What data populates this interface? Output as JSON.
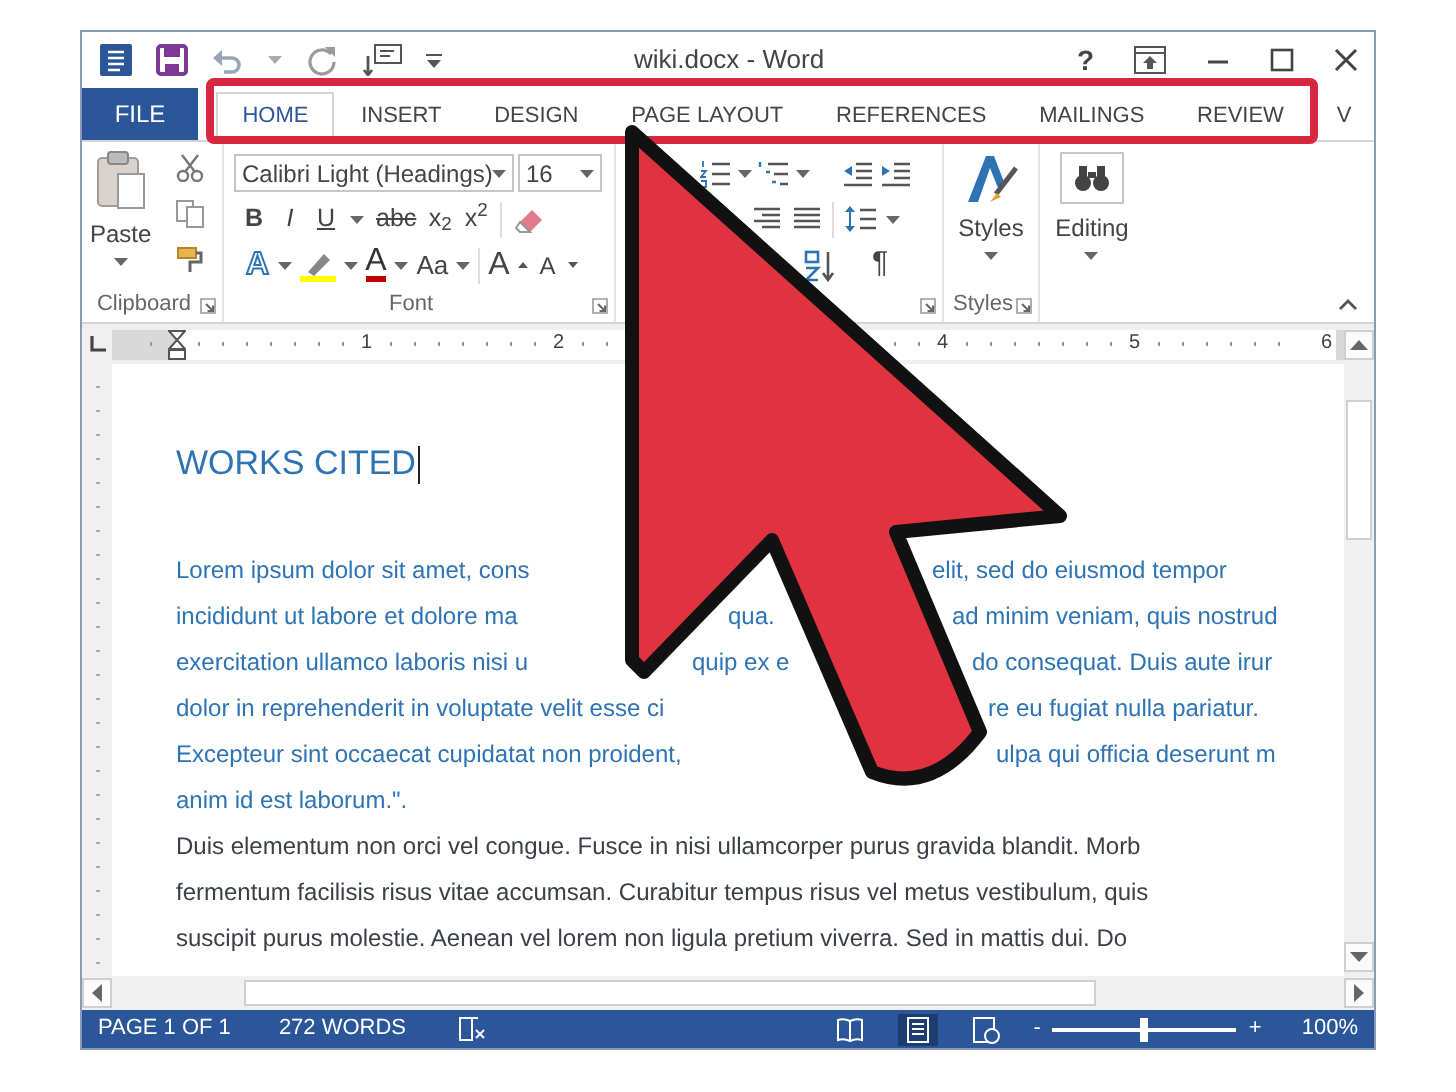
{
  "window": {
    "title": "wiki.docx - Word",
    "help": "?"
  },
  "tabs": [
    {
      "label": "FILE",
      "kind": "file",
      "selected": false
    },
    {
      "label": "HOME",
      "kind": "tab",
      "selected": true
    },
    {
      "label": "INSERT",
      "kind": "tab",
      "selected": false
    },
    {
      "label": "DESIGN",
      "kind": "tab",
      "selected": false
    },
    {
      "label": "PAGE LAYOUT",
      "kind": "tab",
      "selected": false
    },
    {
      "label": "REFERENCES",
      "kind": "tab",
      "selected": false
    },
    {
      "label": "MAILINGS",
      "kind": "tab",
      "selected": false
    },
    {
      "label": "REVIEW",
      "kind": "tab",
      "selected": false
    },
    {
      "label": "V",
      "kind": "tab",
      "selected": false
    }
  ],
  "clipboard": {
    "paste_label": "Paste",
    "group_label": "Clipboard"
  },
  "font": {
    "font_name": "Calibri Light (Headings)",
    "font_size": "16",
    "format_buttons": [
      "B",
      "I",
      "U",
      "abc",
      "x$_{2}$",
      "x$^{2}$"
    ],
    "text_effects": "A",
    "font_color": "A",
    "change_case": "Aa",
    "grow": "A",
    "shrink": "A",
    "group_label": "Font"
  },
  "paragraph": {
    "show_marks": "¶"
  },
  "styles": {
    "button_label": "Styles",
    "group_label": "Styles"
  },
  "editing": {
    "button_label": "Editing"
  },
  "ruler": {
    "numbers": [
      "1",
      "2",
      "4",
      "5",
      "6"
    ]
  },
  "document": {
    "heading": "WORKS CITED",
    "paragraphs": [
      {
        "kind": "accent",
        "lines": [
          [
            "Lorem ipsum dolor sit amet, cons",
            "elit, sed do eiusmod tempor"
          ],
          [
            "incididunt ut labore et dolore ma",
            "qua.",
            "ad minim veniam, quis nostrud"
          ],
          [
            "exercitation ullamco laboris nisi u",
            "quip ex e",
            "do consequat. Duis aute irur"
          ],
          [
            "dolor in reprehenderit in voluptate velit esse ci",
            "re eu fugiat nulla pariatur."
          ],
          [
            "Excepteur sint occaecat cupidatat non proident,",
            "ulpa qui officia deserunt m"
          ],
          [
            "anim id est laborum.\"."
          ]
        ]
      },
      {
        "kind": "plain",
        "lines": [
          [
            "Duis elementum non orci vel congue. Fusce in nisi ullamcorper purus gravida blandit. Morb"
          ],
          [
            "fermentum facilisis risus vitae accumsan. Curabitur tempus risus vel metus vestibulum, quis"
          ],
          [
            "suscipit purus molestie. Aenean vel lorem non ligula pretium viverra. Sed in mattis dui. Do"
          ]
        ]
      }
    ]
  },
  "status_bar": {
    "page": "PAGE 1 OF 1",
    "words": "272 WORDS",
    "views": [
      {
        "kind": "read",
        "selected": false
      },
      {
        "kind": "print",
        "selected": true
      },
      {
        "kind": "web",
        "selected": false
      }
    ],
    "zoom_out": "-",
    "zoom_in": "+",
    "zoom_slider": {
      "level": 0.5
    },
    "zoom_percent": "100%"
  }
}
